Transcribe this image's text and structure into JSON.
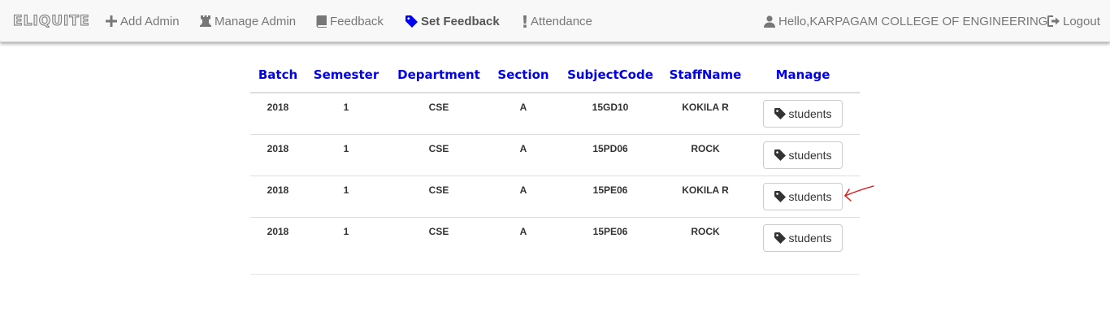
{
  "navbar": {
    "brand": "ELIQUITE",
    "items": [
      {
        "label": "Add Admin",
        "icon": "plus-icon"
      },
      {
        "label": "Manage Admin",
        "icon": "rook-icon"
      },
      {
        "label": "Feedback",
        "icon": "book-icon"
      },
      {
        "label": "Set Feedback",
        "icon": "tag-icon",
        "active": true
      },
      {
        "label": "Attendance",
        "icon": "exclamation-icon"
      }
    ],
    "user": {
      "label": "Hello,KARPAGAM COLLEGE OF ENGINEERING",
      "icon": "user-icon"
    },
    "logout": {
      "label": "Logout",
      "icon": "logout-icon"
    }
  },
  "table": {
    "headers": [
      "Batch",
      "Semester",
      "Department",
      "Section",
      "SubjectCode",
      "StaffName",
      "Manage"
    ],
    "rows": [
      {
        "batch": "2018",
        "semester": "1",
        "department": "CSE",
        "section": "A",
        "subject_code": "15GD10",
        "staff_name": "KOKILA R",
        "manage_label": "students"
      },
      {
        "batch": "2018",
        "semester": "1",
        "department": "CSE",
        "section": "A",
        "subject_code": "15PD06",
        "staff_name": "ROCK",
        "manage_label": "students"
      },
      {
        "batch": "2018",
        "semester": "1",
        "department": "CSE",
        "section": "A",
        "subject_code": "15PE06",
        "staff_name": "KOKILA R",
        "manage_label": "students"
      },
      {
        "batch": "2018",
        "semester": "1",
        "department": "CSE",
        "section": "A",
        "subject_code": "15PE06",
        "staff_name": "ROCK",
        "manage_label": "students"
      }
    ]
  },
  "colors": {
    "header_text": "#0000ee",
    "annotation_arrow": "#e01010",
    "navbar_bg": "#f8f8f8"
  }
}
